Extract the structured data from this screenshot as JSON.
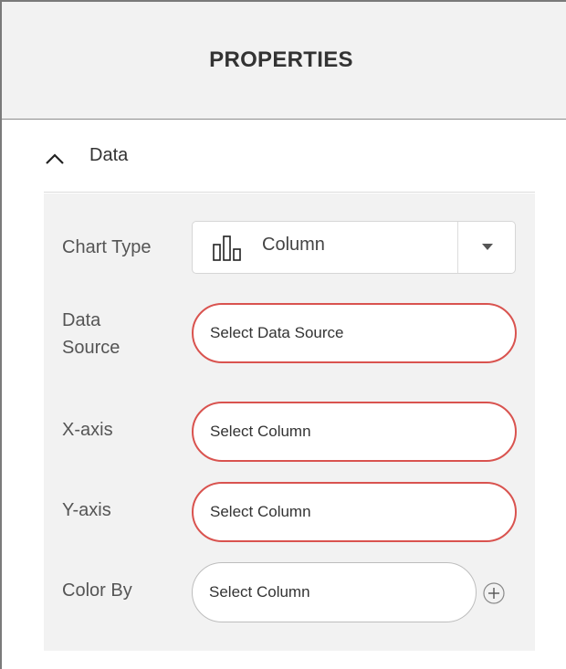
{
  "header": {
    "title": "PROPERTIES"
  },
  "section": {
    "label": "Data",
    "expanded": true
  },
  "fields": {
    "chart_type": {
      "label": "Chart Type",
      "value": "Column",
      "icon": "column-chart-icon"
    },
    "data_source": {
      "label_line1": "Data",
      "label_line2": "Source",
      "placeholder": "Select Data Source"
    },
    "x_axis": {
      "label": "X-axis",
      "placeholder": "Select Column"
    },
    "y_axis": {
      "label": "Y-axis",
      "placeholder": "Select Column"
    },
    "color_by": {
      "label": "Color By",
      "placeholder": "Select Column"
    }
  },
  "colors": {
    "required_border": "#d9534f",
    "panel_bg": "#f2f2f2"
  }
}
